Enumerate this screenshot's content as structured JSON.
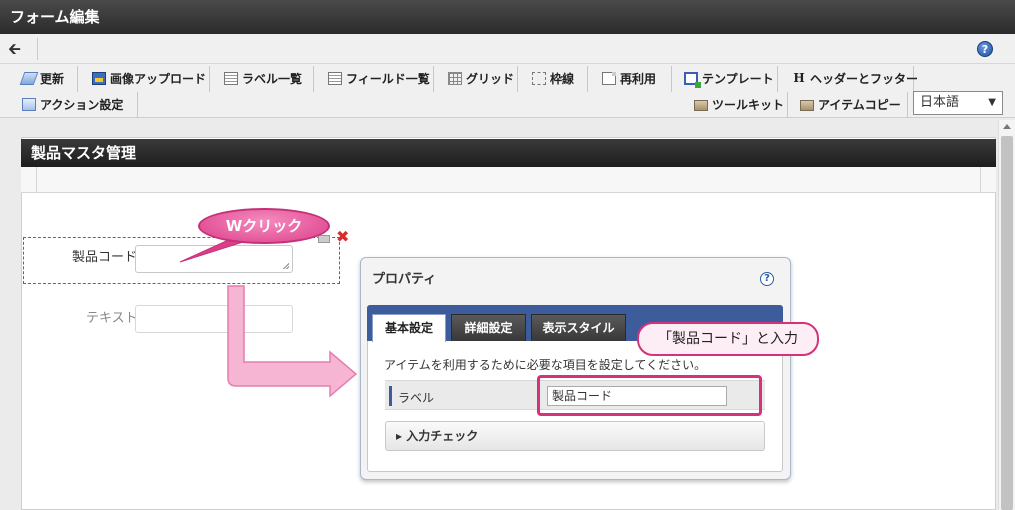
{
  "window": {
    "title": "フォーム編集"
  },
  "nav": {
    "back_glyph": "🡰",
    "help_glyph": "?"
  },
  "toolbar": {
    "row1": [
      {
        "label": "更新",
        "icon": "update-icon"
      },
      {
        "label": "画像アップロード",
        "icon": "image-upload-icon"
      },
      {
        "label": "ラベル一覧",
        "icon": "label-list-icon"
      },
      {
        "label": "フィールド一覧",
        "icon": "field-list-icon"
      },
      {
        "label": "グリッド",
        "icon": "grid-icon"
      },
      {
        "label": "枠線",
        "icon": "border-icon"
      },
      {
        "label": "再利用",
        "icon": "reuse-icon"
      },
      {
        "label": "テンプレート",
        "icon": "template-icon"
      },
      {
        "label": "ヘッダーとフッター",
        "icon": "header-footer-icon",
        "glyph": "H"
      }
    ],
    "row2_left": {
      "label": "アクション設定",
      "icon": "action-settings-icon"
    },
    "row2_right": [
      {
        "label": "ツールキット",
        "icon": "toolkit-icon"
      },
      {
        "label": "アイテムコピー",
        "icon": "item-copy-icon"
      }
    ],
    "language": {
      "value": "日本語",
      "arrow": "▼"
    }
  },
  "form": {
    "title": "製品マスタ管理",
    "fields": [
      {
        "label": "製品コード"
      },
      {
        "label": "テキスト"
      }
    ],
    "delete_glyph": "✖"
  },
  "annotations": {
    "double_click": "Wクリック",
    "input_hint": "「製品コード」と入力"
  },
  "properties_dialog": {
    "title": "プロパティ",
    "help_glyph": "?",
    "tabs": [
      {
        "label": "基本設定",
        "active": true
      },
      {
        "label": "詳細設定",
        "active": false
      },
      {
        "label": "表示スタイル",
        "active": false
      }
    ],
    "description": "アイテムを利用するために必要な項目を設定してください。",
    "label_field": {
      "label": "ラベル",
      "value": "製品コード"
    },
    "input_check": {
      "arrow": "▸",
      "label": "入力チェック"
    }
  },
  "colors": {
    "accent_pink": "#e0489a",
    "tab_blue": "#3d5c9b",
    "delete_red": "#d82b2b"
  }
}
